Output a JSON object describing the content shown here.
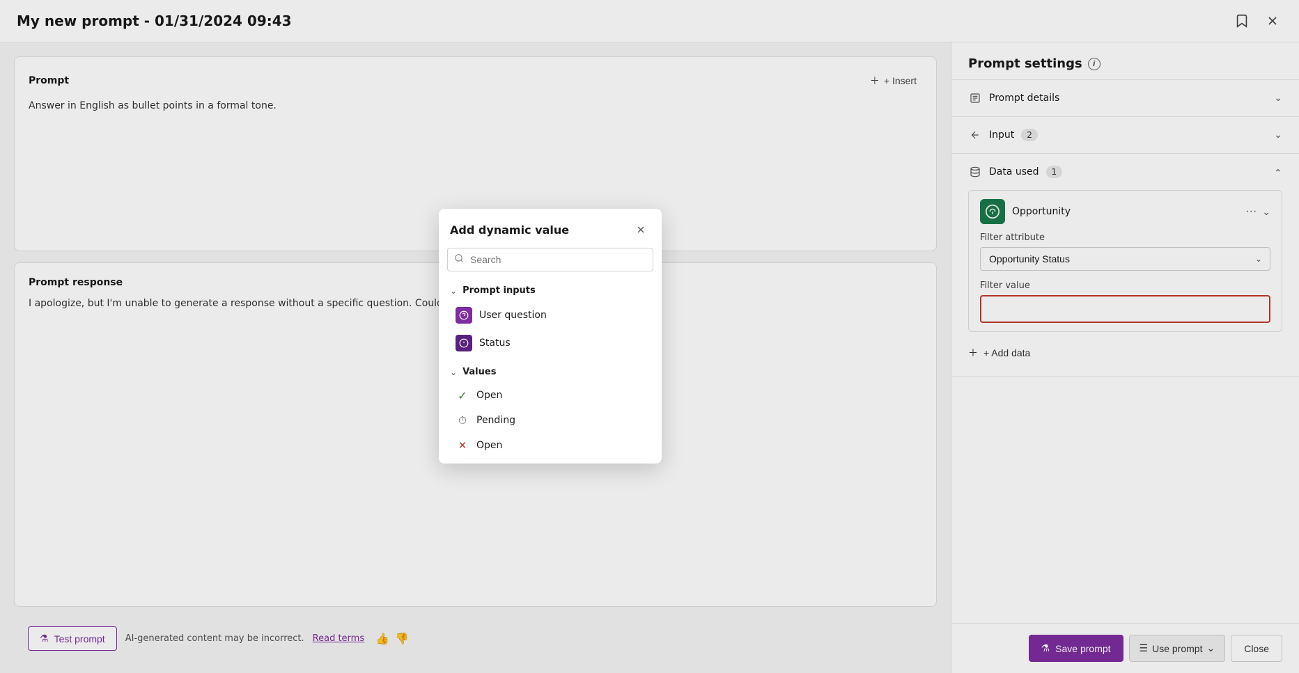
{
  "window": {
    "title": "My new prompt - 01/31/2024 09:43"
  },
  "prompt_section": {
    "label": "Prompt",
    "insert_label": "+ Insert",
    "content": "Answer in English as bullet points in a formal tone."
  },
  "response_section": {
    "label": "Prompt response",
    "content": "I apologize, but I'm unable to generate a response without a specific question. Could you please provide more de..."
  },
  "bottom_bar": {
    "test_prompt_label": "Test prompt",
    "ai_notice": "AI-generated content may be incorrect.",
    "read_terms_label": "Read terms"
  },
  "right_panel": {
    "title": "Prompt settings",
    "sections": [
      {
        "id": "prompt-details",
        "label": "Prompt details",
        "expanded": false,
        "badge": null
      },
      {
        "id": "input",
        "label": "Input",
        "expanded": false,
        "badge": "2"
      },
      {
        "id": "data-used",
        "label": "Data used",
        "expanded": true,
        "badge": "1"
      }
    ],
    "opportunity": {
      "name": "Opportunity",
      "filter_attribute_label": "Filter attribute",
      "filter_attribute_value": "Opportunity Status",
      "filter_value_label": "Filter value",
      "filter_value": ""
    },
    "add_data_label": "+ Add data",
    "footer": {
      "save_label": "Save prompt",
      "use_label": "Use prompt",
      "close_label": "Close"
    }
  },
  "popup": {
    "title": "Add dynamic value",
    "search_placeholder": "Search",
    "sections": [
      {
        "id": "prompt-inputs",
        "label": "Prompt inputs",
        "expanded": true,
        "items": [
          {
            "id": "user-question",
            "label": "User question",
            "icon_type": "purple"
          },
          {
            "id": "status",
            "label": "Status",
            "icon_type": "purple-dark"
          }
        ]
      },
      {
        "id": "values",
        "label": "Values",
        "expanded": true,
        "items": [
          {
            "id": "open-check",
            "label": "Open",
            "icon": "✓"
          },
          {
            "id": "pending",
            "label": "Pending",
            "icon": "⏱"
          },
          {
            "id": "open-x",
            "label": "Open",
            "icon": "✕"
          }
        ]
      }
    ]
  }
}
